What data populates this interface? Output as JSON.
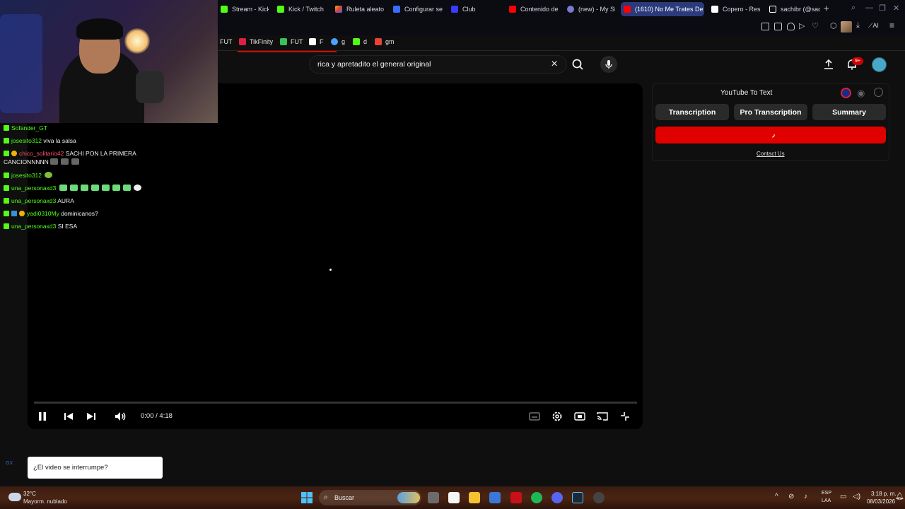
{
  "browser": {
    "tabs": [
      {
        "label": "Stream - Kick",
        "color": "#53fc18"
      },
      {
        "label": "Kick / Twitch",
        "color": "#53fc18"
      },
      {
        "label": "Ruleta aleato",
        "color": "#e6b800"
      },
      {
        "label": "Configurar se",
        "color": "#3b6cff"
      },
      {
        "label": "Club",
        "color": "#3b3bff"
      },
      {
        "label": "Contenido de",
        "color": "#ff0000"
      },
      {
        "label": "(new) - My Si",
        "color": "#7a7ad0"
      },
      {
        "label": "(1610) No Me Trates De",
        "color": "#ff0000"
      },
      {
        "label": "Copero - Res",
        "color": "#ffffff"
      },
      {
        "label": "sachibr (@sac",
        "color": "#ffffff"
      }
    ],
    "new_tab": "+",
    "ai_label": "AI"
  },
  "bookmarks": [
    {
      "label": "FUT",
      "color": ""
    },
    {
      "label": "TikFinity",
      "color": "#e02040"
    },
    {
      "label": "FUT",
      "color": "#3ac15a"
    },
    {
      "label": "F",
      "color": "#ffffff"
    },
    {
      "label": "g",
      "color": "#4aa3ff"
    },
    {
      "label": "d",
      "color": "#53fc18"
    },
    {
      "label": "gm",
      "color": "#ea4335"
    }
  ],
  "youtube": {
    "search_query": "rica y apretadito el general original",
    "clear_icon": "×",
    "notification_badge": "9+"
  },
  "chat": [
    {
      "user": "Sofander_GT",
      "text": "",
      "color": "green"
    },
    {
      "user": "josesito312",
      "text": "viva la salsa",
      "color": "green"
    },
    {
      "user": "chico_solitario42",
      "text": "SACHI PON LA PRIMERA",
      "color": "red"
    },
    {
      "user": "",
      "text": "CANCIONNNNN",
      "color": "green"
    },
    {
      "user": "josesito312",
      "text": "",
      "color": "green"
    },
    {
      "user": "una_personaxd3",
      "text": "",
      "color": "green"
    },
    {
      "user": "una_personaxd3",
      "text": "AURA",
      "color": "green"
    },
    {
      "user": "yadi0310My",
      "text": "dominicanos?",
      "color": "green"
    },
    {
      "user": "una_personaxd3",
      "text": "SI ESA",
      "color": "green"
    }
  ],
  "player": {
    "time": "0:00 / 4:18",
    "progress": 0
  },
  "extension": {
    "title": "YouTube To Text",
    "tabs": [
      "Transcription",
      "Pro Transcription",
      "Summary"
    ],
    "contact": "Contact Us"
  },
  "prompt": {
    "text": "¿El video se interrumpe?",
    "side_label": "GX"
  },
  "taskbar": {
    "temperature": "32°C",
    "weather": "Mayorm. nublado",
    "search_placeholder": "Buscar",
    "lang_top": "ESP",
    "lang_bottom": "LAA",
    "time": "3:18 p. m.",
    "date": "08/03/2026"
  }
}
